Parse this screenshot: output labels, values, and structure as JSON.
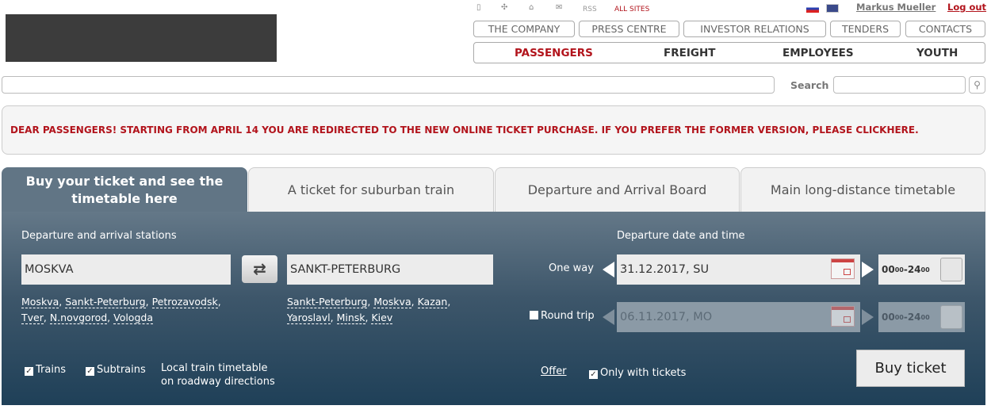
{
  "header": {
    "top_icons": [
      "mobile-icon",
      "sitemap-icon",
      "home-icon",
      "mail-icon"
    ],
    "rss": "RSS",
    "all_sites": "ALL SITES",
    "user": "Markus Mueller",
    "logout": "Log out",
    "secondary_nav": [
      "THE COMPANY",
      "PRESS CENTRE",
      "INVESTOR RELATIONS",
      "TENDERS",
      "CONTACTS"
    ],
    "main_nav": [
      "PASSENGERS",
      "FREIGHT",
      "EMPLOYEES",
      "YOUTH"
    ],
    "search_label": "Search"
  },
  "notice": {
    "text": "DEAR PASSENGERS! STARTING FROM APRIL 14 YOU ARE REDIRECTED TO THE NEW ONLINE TICKET PURCHASE. IF YOU PREFER THE FORMER VERSION, PLEASE CLICK ",
    "link": "HERE",
    "end": "."
  },
  "tabs": [
    "Buy your ticket and see the timetable here",
    "A ticket for suburban train",
    "Departure and Arrival Board",
    "Main long-distance timetable"
  ],
  "form": {
    "stations_label": "Departure and arrival stations",
    "from": "MOSKVA",
    "to": "SANKT-PETERBURG",
    "from_suggestions": [
      "Moskva",
      "Sankt-Peterburg",
      "Petrozavodsk",
      "Tver",
      "N.novgorod",
      "Vologda"
    ],
    "to_suggestions": [
      "Sankt-Peterburg",
      "Moskva",
      "Kazan",
      "Yaroslavl",
      "Minsk",
      "Kiev"
    ],
    "trains": "Trains",
    "subtrains": "Subtrains",
    "local_1": "Local train timetable",
    "local_2": "on roadway directions",
    "date_label": "Departure date and time",
    "one_way": "One way",
    "one_way_date": "31.12.2017, SU",
    "round_trip": "Round trip",
    "round_trip_date": "06.11.2017, MO",
    "time_from": "00",
    "time_from_min": "00",
    "time_to": "24",
    "time_to_min": "00",
    "offer": "Offer",
    "only_with_tickets": "Only with tickets",
    "buy": "Buy ticket"
  },
  "colors": {
    "accent": "#b2141c",
    "panel": "#3d566a"
  }
}
